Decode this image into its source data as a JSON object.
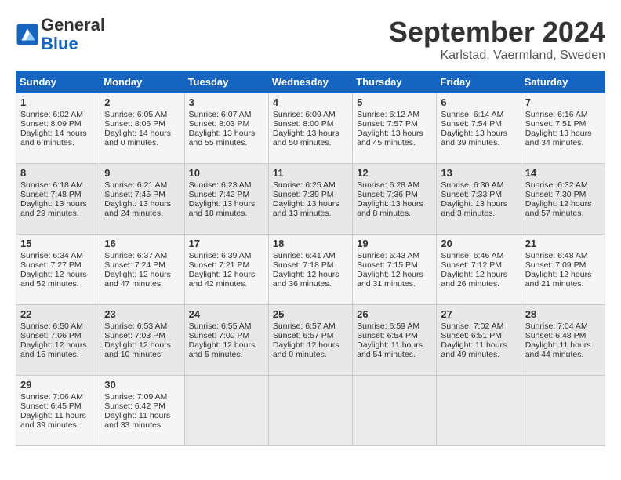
{
  "header": {
    "logo_general": "General",
    "logo_blue": "Blue",
    "month_title": "September 2024",
    "location": "Karlstad, Vaermland, Sweden"
  },
  "days_of_week": [
    "Sunday",
    "Monday",
    "Tuesday",
    "Wednesday",
    "Thursday",
    "Friday",
    "Saturday"
  ],
  "weeks": [
    [
      {
        "day": "1",
        "info": "Sunrise: 6:02 AM\nSunset: 8:09 PM\nDaylight: 14 hours and 6 minutes."
      },
      {
        "day": "2",
        "info": "Sunrise: 6:05 AM\nSunset: 8:06 PM\nDaylight: 14 hours and 0 minutes."
      },
      {
        "day": "3",
        "info": "Sunrise: 6:07 AM\nSunset: 8:03 PM\nDaylight: 13 hours and 55 minutes."
      },
      {
        "day": "4",
        "info": "Sunrise: 6:09 AM\nSunset: 8:00 PM\nDaylight: 13 hours and 50 minutes."
      },
      {
        "day": "5",
        "info": "Sunrise: 6:12 AM\nSunset: 7:57 PM\nDaylight: 13 hours and 45 minutes."
      },
      {
        "day": "6",
        "info": "Sunrise: 6:14 AM\nSunset: 7:54 PM\nDaylight: 13 hours and 39 minutes."
      },
      {
        "day": "7",
        "info": "Sunrise: 6:16 AM\nSunset: 7:51 PM\nDaylight: 13 hours and 34 minutes."
      }
    ],
    [
      {
        "day": "8",
        "info": "Sunrise: 6:18 AM\nSunset: 7:48 PM\nDaylight: 13 hours and 29 minutes."
      },
      {
        "day": "9",
        "info": "Sunrise: 6:21 AM\nSunset: 7:45 PM\nDaylight: 13 hours and 24 minutes."
      },
      {
        "day": "10",
        "info": "Sunrise: 6:23 AM\nSunset: 7:42 PM\nDaylight: 13 hours and 18 minutes."
      },
      {
        "day": "11",
        "info": "Sunrise: 6:25 AM\nSunset: 7:39 PM\nDaylight: 13 hours and 13 minutes."
      },
      {
        "day": "12",
        "info": "Sunrise: 6:28 AM\nSunset: 7:36 PM\nDaylight: 13 hours and 8 minutes."
      },
      {
        "day": "13",
        "info": "Sunrise: 6:30 AM\nSunset: 7:33 PM\nDaylight: 13 hours and 3 minutes."
      },
      {
        "day": "14",
        "info": "Sunrise: 6:32 AM\nSunset: 7:30 PM\nDaylight: 12 hours and 57 minutes."
      }
    ],
    [
      {
        "day": "15",
        "info": "Sunrise: 6:34 AM\nSunset: 7:27 PM\nDaylight: 12 hours and 52 minutes."
      },
      {
        "day": "16",
        "info": "Sunrise: 6:37 AM\nSunset: 7:24 PM\nDaylight: 12 hours and 47 minutes."
      },
      {
        "day": "17",
        "info": "Sunrise: 6:39 AM\nSunset: 7:21 PM\nDaylight: 12 hours and 42 minutes."
      },
      {
        "day": "18",
        "info": "Sunrise: 6:41 AM\nSunset: 7:18 PM\nDaylight: 12 hours and 36 minutes."
      },
      {
        "day": "19",
        "info": "Sunrise: 6:43 AM\nSunset: 7:15 PM\nDaylight: 12 hours and 31 minutes."
      },
      {
        "day": "20",
        "info": "Sunrise: 6:46 AM\nSunset: 7:12 PM\nDaylight: 12 hours and 26 minutes."
      },
      {
        "day": "21",
        "info": "Sunrise: 6:48 AM\nSunset: 7:09 PM\nDaylight: 12 hours and 21 minutes."
      }
    ],
    [
      {
        "day": "22",
        "info": "Sunrise: 6:50 AM\nSunset: 7:06 PM\nDaylight: 12 hours and 15 minutes."
      },
      {
        "day": "23",
        "info": "Sunrise: 6:53 AM\nSunset: 7:03 PM\nDaylight: 12 hours and 10 minutes."
      },
      {
        "day": "24",
        "info": "Sunrise: 6:55 AM\nSunset: 7:00 PM\nDaylight: 12 hours and 5 minutes."
      },
      {
        "day": "25",
        "info": "Sunrise: 6:57 AM\nSunset: 6:57 PM\nDaylight: 12 hours and 0 minutes."
      },
      {
        "day": "26",
        "info": "Sunrise: 6:59 AM\nSunset: 6:54 PM\nDaylight: 11 hours and 54 minutes."
      },
      {
        "day": "27",
        "info": "Sunrise: 7:02 AM\nSunset: 6:51 PM\nDaylight: 11 hours and 49 minutes."
      },
      {
        "day": "28",
        "info": "Sunrise: 7:04 AM\nSunset: 6:48 PM\nDaylight: 11 hours and 44 minutes."
      }
    ],
    [
      {
        "day": "29",
        "info": "Sunrise: 7:06 AM\nSunset: 6:45 PM\nDaylight: 11 hours and 39 minutes."
      },
      {
        "day": "30",
        "info": "Sunrise: 7:09 AM\nSunset: 6:42 PM\nDaylight: 11 hours and 33 minutes."
      },
      null,
      null,
      null,
      null,
      null
    ]
  ]
}
